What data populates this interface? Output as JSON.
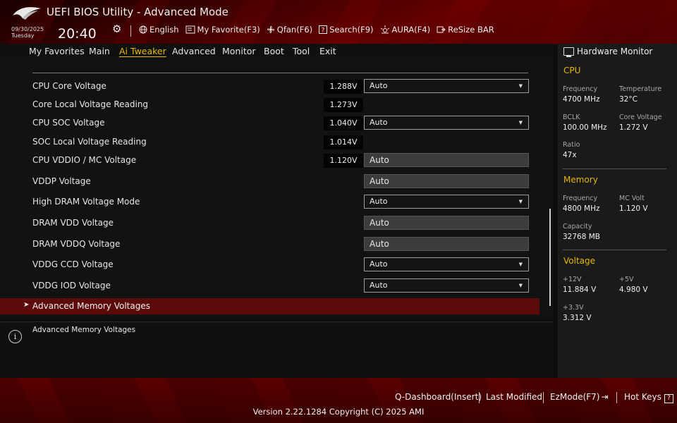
{
  "header": {
    "title": "UEFI BIOS Utility - Advanced Mode",
    "date": "09/30/2025",
    "day": "Tuesday",
    "time": "20:40",
    "toolbar": [
      {
        "label": "English",
        "icon": "globe-icon"
      },
      {
        "label": "My Favorite(F3)",
        "icon": "favorite-icon"
      },
      {
        "label": "Qfan(F6)",
        "icon": "fan-icon"
      },
      {
        "label": "Search(F9)",
        "icon": "search-icon"
      },
      {
        "label": "AURA(F4)",
        "icon": "aura-icon"
      },
      {
        "label": "ReSize BAR",
        "icon": "resize-bar-icon"
      }
    ]
  },
  "menu": {
    "items": [
      "My Favorites",
      "Main",
      "Ai Tweaker",
      "Advanced",
      "Monitor",
      "Boot",
      "Tool",
      "Exit"
    ],
    "active": "Ai Tweaker"
  },
  "settings": [
    {
      "label": "CPU Core Voltage",
      "reading": "1.288V",
      "value": "Auto",
      "control": "select"
    },
    {
      "label": "Core Local Voltage Reading",
      "reading": "1.273V",
      "value": "",
      "control": "none"
    },
    {
      "label": "CPU SOC Voltage",
      "reading": "1.040V",
      "value": "Auto",
      "control": "select"
    },
    {
      "label": "SOC Local Voltage Reading",
      "reading": "1.014V",
      "value": "",
      "control": "none"
    },
    {
      "label": "CPU VDDIO / MC Voltage",
      "reading": "1.120V",
      "value": "Auto",
      "control": "text"
    },
    {
      "label": "VDDP Voltage",
      "reading": "",
      "value": "Auto",
      "control": "text"
    },
    {
      "label": "High DRAM Voltage Mode",
      "reading": "",
      "value": "Auto",
      "control": "select"
    },
    {
      "label": "DRAM VDD Voltage",
      "reading": "",
      "value": "Auto",
      "control": "text"
    },
    {
      "label": "DRAM VDDQ Voltage",
      "reading": "",
      "value": "Auto",
      "control": "text"
    },
    {
      "label": "VDDG CCD Voltage",
      "reading": "",
      "value": "Auto",
      "control": "select"
    },
    {
      "label": "VDDG IOD Voltage",
      "reading": "",
      "value": "Auto",
      "control": "select"
    }
  ],
  "submenu": {
    "label": "Advanced Memory Voltages"
  },
  "help": {
    "text": "Advanced Memory Voltages"
  },
  "hardware_monitor": {
    "title": "Hardware Monitor",
    "cpu": {
      "title": "CPU",
      "frequency_label": "Frequency",
      "frequency": "4700 MHz",
      "temperature_label": "Temperature",
      "temperature": "32°C",
      "bclk_label": "BCLK",
      "bclk": "100.00 MHz",
      "core_voltage_label": "Core Voltage",
      "core_voltage": "1.272 V",
      "ratio_label": "Ratio",
      "ratio": "47x"
    },
    "memory": {
      "title": "Memory",
      "frequency_label": "Frequency",
      "frequency": "4800 MHz",
      "mc_volt_label": "MC Volt",
      "mc_volt": "1.120 V",
      "capacity_label": "Capacity",
      "capacity": "32768 MB"
    },
    "voltage": {
      "title": "Voltage",
      "v12_label": "+12V",
      "v12": "11.884 V",
      "v5_label": "+5V",
      "v5": "4.980 V",
      "v33_label": "+3.3V",
      "v33": "3.312 V"
    }
  },
  "footer": {
    "qdashboard": "Q-Dashboard(Insert)",
    "last_modified": "Last Modified",
    "ezmode": "EzMode(F7)",
    "hotkeys": "Hot Keys",
    "hotkeys_key": "?",
    "version": "Version 2.22.1284 Copyright (C) 2025 AMI"
  },
  "colors": {
    "accent": "#e6b800",
    "highlight_row": "#5c0a0a",
    "header_red": "#8a0000"
  }
}
